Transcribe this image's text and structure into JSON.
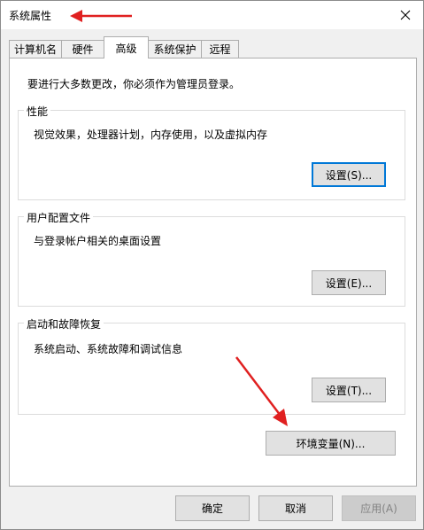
{
  "window": {
    "title": "系统属性"
  },
  "tabs": [
    {
      "label": "计算机名",
      "active": false
    },
    {
      "label": "硬件",
      "active": false
    },
    {
      "label": "高级",
      "active": true
    },
    {
      "label": "系统保护",
      "active": false
    },
    {
      "label": "远程",
      "active": false
    }
  ],
  "advanced": {
    "admin_notice": "要进行大多数更改，你必须作为管理员登录。",
    "performance": {
      "title": "性能",
      "description": "视觉效果，处理器计划，内存使用，以及虚拟内存",
      "button": "设置(S)..."
    },
    "user_profiles": {
      "title": "用户配置文件",
      "description": "与登录帐户相关的桌面设置",
      "button": "设置(E)..."
    },
    "startup_recovery": {
      "title": "启动和故障恢复",
      "description": "系统启动、系统故障和调试信息",
      "button": "设置(T)..."
    },
    "env_vars_button": "环境变量(N)..."
  },
  "footer": {
    "ok": "确定",
    "cancel": "取消",
    "apply": "应用(A)"
  },
  "colors": {
    "annotation_arrow": "#e02020",
    "focus_border": "#0078d7"
  },
  "icons": {
    "close": "close-icon"
  }
}
